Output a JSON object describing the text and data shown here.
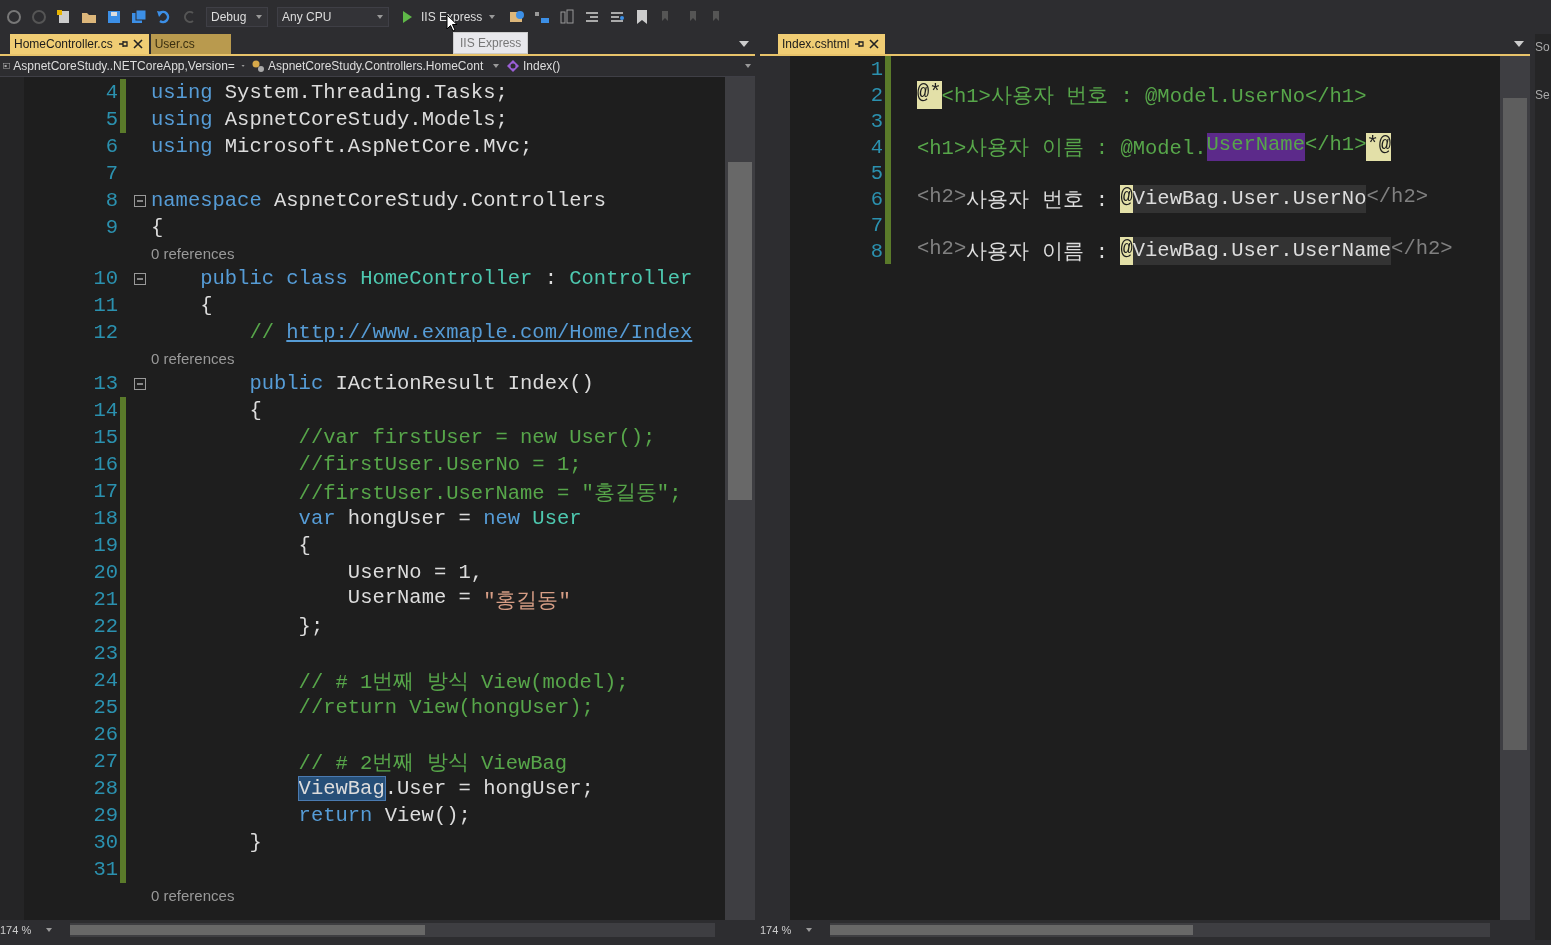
{
  "toolbar": {
    "configuration": "Debug",
    "platform": "Any CPU",
    "run_target": "IIS Express",
    "tooltip": "IIS Express"
  },
  "left_pane": {
    "tabs": [
      {
        "label": "HomeController.cs",
        "selected": true
      },
      {
        "label": "User.cs",
        "selected": false
      }
    ],
    "navigation": [
      "AspnetCoreStudy..NETCoreApp,Version=",
      "AspnetCoreStudy.Controllers.HomeCont",
      "Index()"
    ],
    "lines": [
      {
        "kind": "code",
        "number": "4",
        "modified": true,
        "collapsible": false,
        "tokens": [
          {
            "kind": "kw",
            "text": "using"
          },
          {
            "kind": "plain",
            "text": " System.Threading.Tasks;"
          }
        ]
      },
      {
        "kind": "code",
        "number": "5",
        "modified": true,
        "collapsible": false,
        "tokens": [
          {
            "kind": "kw",
            "text": "using"
          },
          {
            "kind": "plain",
            "text": " AspnetCoreStudy.Models;"
          }
        ]
      },
      {
        "kind": "code",
        "number": "6",
        "modified": false,
        "collapsible": false,
        "tokens": [
          {
            "kind": "kw",
            "text": "using"
          },
          {
            "kind": "plain",
            "text": " Microsoft.AspNetCore.Mvc;"
          }
        ]
      },
      {
        "kind": "code",
        "number": "7",
        "modified": false,
        "collapsible": false
      },
      {
        "kind": "code",
        "number": "8",
        "modified": false,
        "collapsible": true,
        "tokens": [
          {
            "kind": "kw",
            "text": "namespace"
          },
          {
            "kind": "plain",
            "text": " AspnetCoreStudy.Controllers"
          }
        ]
      },
      {
        "kind": "code",
        "number": "9",
        "modified": false,
        "collapsible": false,
        "tokens": [
          {
            "kind": "plain",
            "text": "{"
          }
        ]
      },
      {
        "kind": "lens",
        "text": "0 references"
      },
      {
        "kind": "code",
        "number": "10",
        "modified": false,
        "collapsible": true,
        "tokens": [
          {
            "kind": "kw",
            "text": "    public"
          },
          {
            "kind": "kw",
            "text": " class"
          },
          {
            "kind": "type",
            "text": " HomeController"
          },
          {
            "kind": "plain",
            "text": " :"
          },
          {
            "kind": "type",
            "text": " Controller"
          }
        ]
      },
      {
        "kind": "code",
        "number": "11",
        "modified": false,
        "collapsible": false,
        "tokens": [
          {
            "kind": "plain",
            "text": "    {"
          }
        ]
      },
      {
        "kind": "code",
        "number": "12",
        "modified": false,
        "collapsible": false,
        "tokens": [
          {
            "kind": "comment",
            "text": "        //"
          },
          {
            "kind": "link",
            "text": " http://www.exmaple.com/Home/Index"
          }
        ]
      },
      {
        "kind": "lens",
        "text": "0 references"
      },
      {
        "kind": "code",
        "number": "13",
        "modified": false,
        "collapsible": true,
        "tokens": [
          {
            "kind": "kw",
            "text": "        public"
          },
          {
            "kind": "plain",
            "text": " IActionResult Index()"
          }
        ]
      },
      {
        "kind": "code",
        "number": "14",
        "modified": true,
        "collapsible": false,
        "tokens": [
          {
            "kind": "plain",
            "text": "        {"
          }
        ]
      },
      {
        "kind": "code",
        "number": "15",
        "modified": true,
        "collapsible": false,
        "tokens": [
          {
            "kind": "comment",
            "text": "            //var firstUser = new User();"
          }
        ]
      },
      {
        "kind": "code",
        "number": "16",
        "modified": true,
        "collapsible": false,
        "tokens": [
          {
            "kind": "comment",
            "text": "            //firstUser.UserNo = 1;"
          }
        ]
      },
      {
        "kind": "code",
        "number": "17",
        "modified": true,
        "collapsible": false,
        "tokens": [
          {
            "kind": "comment",
            "text": "            //firstUser.UserName = \"홍길동\";"
          }
        ]
      },
      {
        "kind": "code",
        "number": "18",
        "modified": true,
        "collapsible": false,
        "tokens": [
          {
            "kind": "kw",
            "text": "            var"
          },
          {
            "kind": "plain",
            "text": " hongUser ="
          },
          {
            "kind": "kw",
            "text": " new"
          },
          {
            "kind": "type",
            "text": " User"
          }
        ]
      },
      {
        "kind": "code",
        "number": "19",
        "modified": true,
        "collapsible": false,
        "tokens": [
          {
            "kind": "plain",
            "text": "            {"
          }
        ]
      },
      {
        "kind": "code",
        "number": "20",
        "modified": true,
        "collapsible": false,
        "tokens": [
          {
            "kind": "plain",
            "text": "                UserNo = 1,"
          }
        ]
      },
      {
        "kind": "code",
        "number": "21",
        "modified": true,
        "collapsible": false,
        "tokens": [
          {
            "kind": "plain",
            "text": "                UserName ="
          },
          {
            "kind": "string",
            "text": " \"홍길동\""
          }
        ]
      },
      {
        "kind": "code",
        "number": "22",
        "modified": true,
        "collapsible": false,
        "tokens": [
          {
            "kind": "plain",
            "text": "            };"
          }
        ]
      },
      {
        "kind": "code",
        "number": "23",
        "modified": true,
        "collapsible": false
      },
      {
        "kind": "code",
        "number": "24",
        "modified": true,
        "collapsible": false,
        "tokens": [
          {
            "kind": "comment",
            "text": "            // # 1번째 방식 View(model);"
          }
        ]
      },
      {
        "kind": "code",
        "number": "25",
        "modified": true,
        "collapsible": false,
        "tokens": [
          {
            "kind": "comment",
            "text": "            //return View(hongUser);"
          }
        ]
      },
      {
        "kind": "code",
        "number": "26",
        "modified": true,
        "collapsible": false
      },
      {
        "kind": "code",
        "number": "27",
        "modified": true,
        "collapsible": false,
        "tokens": [
          {
            "kind": "comment",
            "text": "            // # 2번째 방식 ViewBag"
          }
        ]
      },
      {
        "kind": "code",
        "number": "28",
        "modified": true,
        "collapsible": false,
        "tokens": [
          {
            "kind": "ref",
            "text": "            ViewBag"
          },
          {
            "kind": "plain",
            "text": ".User = hongUser;"
          }
        ]
      },
      {
        "kind": "code",
        "number": "29",
        "modified": true,
        "collapsible": false,
        "tokens": [
          {
            "kind": "kw",
            "text": "            return"
          },
          {
            "kind": "plain",
            "text": " View();"
          }
        ]
      },
      {
        "kind": "code",
        "number": "30",
        "modified": true,
        "collapsible": false,
        "tokens": [
          {
            "kind": "plain",
            "text": "        }"
          }
        ]
      },
      {
        "kind": "code",
        "number": "31",
        "modified": true,
        "collapsible": false
      },
      {
        "kind": "lens",
        "text": "0 references"
      }
    ],
    "zoom": "174 %"
  },
  "right_pane": {
    "tabs": [
      {
        "label": "Index.cshtml",
        "selected": true
      }
    ],
    "lines": [
      {
        "kind": "code",
        "number": "1",
        "modified": true,
        "collapsible": false
      },
      {
        "kind": "code",
        "number": "2",
        "modified": true,
        "collapsible": false,
        "tokens": [
          {
            "kind": "razor",
            "text": "@*"
          },
          {
            "kind": "comment",
            "text": "<h1>사용자 번호 : @Model.UserNo</h1>"
          }
        ]
      },
      {
        "kind": "code",
        "number": "3",
        "modified": true,
        "collapsible": false
      },
      {
        "kind": "code",
        "number": "4",
        "modified": true,
        "collapsible": false,
        "tokens": [
          {
            "kind": "comment",
            "text": "<h1>사용자 이름 : @Model."
          },
          {
            "kind": "sel",
            "text": "UserName"
          },
          {
            "kind": "comment",
            "text": "</h1>"
          },
          {
            "kind": "razor",
            "text": "*@"
          }
        ]
      },
      {
        "kind": "code",
        "number": "5",
        "modified": true,
        "collapsible": false
      },
      {
        "kind": "code",
        "number": "6",
        "modified": true,
        "collapsible": false,
        "tokens": [
          {
            "kind": "tag",
            "text": "<h2>"
          },
          {
            "kind": "plain",
            "text": "사용자 번호 :"
          },
          {
            "kind": "razor",
            "text": " @"
          },
          {
            "kind": "hl",
            "text": "ViewBag.User.UserNo"
          },
          {
            "kind": "tag",
            "text": "</h2>"
          }
        ]
      },
      {
        "kind": "code",
        "number": "7",
        "modified": true,
        "collapsible": false
      },
      {
        "kind": "code",
        "number": "8",
        "modified": true,
        "collapsible": false,
        "tokens": [
          {
            "kind": "tag",
            "text": "<h2>"
          },
          {
            "kind": "plain",
            "text": "사용자 이름 :"
          },
          {
            "kind": "razor",
            "text": " @"
          },
          {
            "kind": "hl",
            "text": "ViewBag.User.UserName"
          },
          {
            "kind": "tag",
            "text": "</h2>"
          }
        ]
      }
    ],
    "zoom": "174 %"
  },
  "side_panel": {
    "labels": [
      "So",
      "Se"
    ]
  }
}
